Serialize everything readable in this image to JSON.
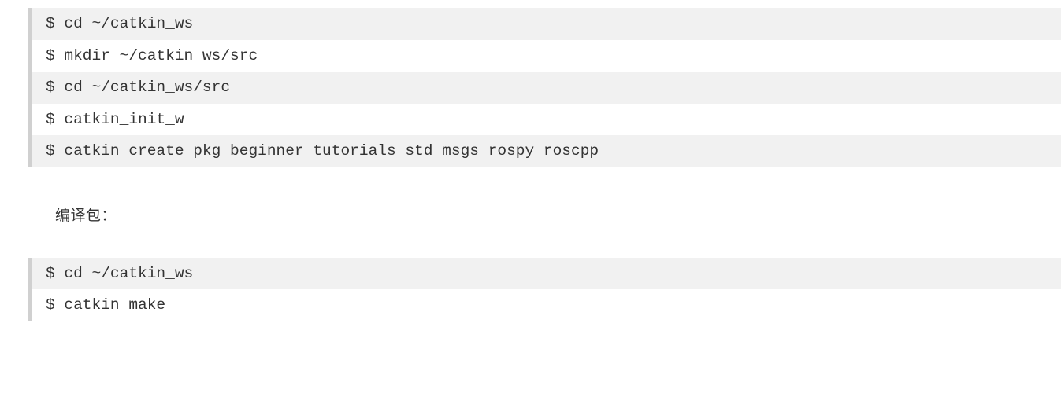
{
  "block1": {
    "lines": [
      "$ cd ~/catkin_ws",
      "$ mkdir ~/catkin_ws/src",
      "$ cd ~/catkin_ws/src",
      "$ catkin_init_w",
      "$ catkin_create_pkg beginner_tutorials std_msgs rospy roscpp"
    ]
  },
  "paragraph1": "编译包：",
  "block2": {
    "lines": [
      "$ cd ~/catkin_ws",
      "$ catkin_make"
    ]
  }
}
